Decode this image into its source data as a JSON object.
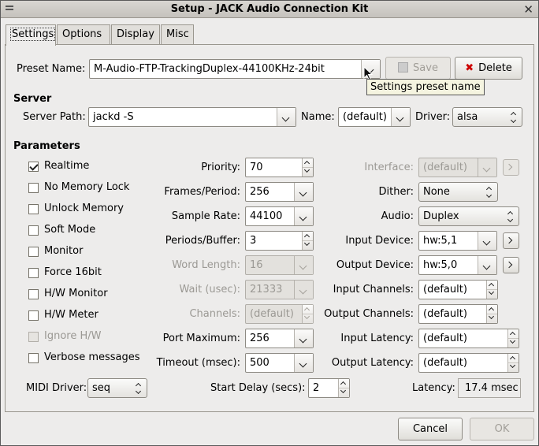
{
  "window": {
    "title": "Setup - JACK Audio Connection Kit"
  },
  "tabs": [
    {
      "label": "Settings",
      "active": true
    },
    {
      "label": "Options",
      "active": false
    },
    {
      "label": "Display",
      "active": false
    },
    {
      "label": "Misc",
      "active": false
    }
  ],
  "preset": {
    "label": "Preset Name:",
    "value": "M-Audio-FTP-TrackingDuplex-44100KHz-24bit",
    "save_label": "Save",
    "delete_label": "Delete",
    "tooltip": "Settings preset name"
  },
  "server": {
    "section_label": "Server",
    "path_label": "Server Path:",
    "path_value": "jackd -S",
    "name_label": "Name:",
    "name_value": "(default)",
    "driver_label": "Driver:",
    "driver_value": "alsa"
  },
  "parameters": {
    "section_label": "Parameters",
    "checkboxes": [
      {
        "label": "Realtime",
        "checked": true,
        "enabled": true
      },
      {
        "label": "No Memory Lock",
        "checked": false,
        "enabled": true
      },
      {
        "label": "Unlock Memory",
        "checked": false,
        "enabled": true
      },
      {
        "label": "Soft Mode",
        "checked": false,
        "enabled": true
      },
      {
        "label": "Monitor",
        "checked": false,
        "enabled": true
      },
      {
        "label": "Force 16bit",
        "checked": false,
        "enabled": true
      },
      {
        "label": "H/W Monitor",
        "checked": false,
        "enabled": true
      },
      {
        "label": "H/W Meter",
        "checked": false,
        "enabled": true
      },
      {
        "label": "Ignore H/W",
        "checked": false,
        "enabled": false
      },
      {
        "label": "Verbose messages",
        "checked": false,
        "enabled": true
      }
    ],
    "priority": {
      "label": "Priority:",
      "value": "70"
    },
    "frames_period": {
      "label": "Frames/Period:",
      "value": "256"
    },
    "sample_rate": {
      "label": "Sample Rate:",
      "value": "44100"
    },
    "periods_buffer": {
      "label": "Periods/Buffer:",
      "value": "3"
    },
    "word_length": {
      "label": "Word Length:",
      "value": "16"
    },
    "wait": {
      "label": "Wait (usec):",
      "value": "21333"
    },
    "channels": {
      "label": "Channels:",
      "value": "(default)"
    },
    "port_maximum": {
      "label": "Port Maximum:",
      "value": "256"
    },
    "timeout": {
      "label": "Timeout (msec):",
      "value": "500"
    },
    "interface": {
      "label": "Interface:",
      "value": "(default)"
    },
    "dither": {
      "label": "Dither:",
      "value": "None"
    },
    "audio": {
      "label": "Audio:",
      "value": "Duplex"
    },
    "input_device": {
      "label": "Input Device:",
      "value": "hw:5,1"
    },
    "output_device": {
      "label": "Output Device:",
      "value": "hw:5,0"
    },
    "input_channels": {
      "label": "Input Channels:",
      "value": "(default)"
    },
    "output_channels": {
      "label": "Output Channels:",
      "value": "(default)"
    },
    "input_latency": {
      "label": "Input Latency:",
      "value": "(default)"
    },
    "output_latency": {
      "label": "Output Latency:",
      "value": "(default)"
    },
    "midi_driver": {
      "label": "MIDI Driver:",
      "value": "seq"
    },
    "start_delay": {
      "label": "Start Delay (secs):",
      "value": "2"
    },
    "latency": {
      "label": "Latency:",
      "value": "17.4 msec"
    }
  },
  "footer": {
    "cancel_label": "Cancel",
    "ok_label": "OK"
  },
  "colors": {
    "window_bg": "#edeceb",
    "disabled_text": "#9b9994",
    "delete_icon": "#cc0000"
  }
}
